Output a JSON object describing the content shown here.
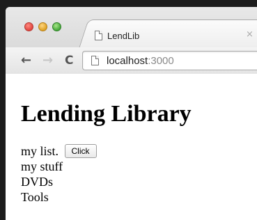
{
  "browser": {
    "tab_title": "LendLib",
    "tab_close": "×",
    "url_host": "localhost",
    "url_port": ":3000",
    "nav": {
      "back": "←",
      "forward": "→",
      "reload": "C"
    }
  },
  "page": {
    "heading": "Lending Library",
    "list_label": "my list.",
    "click_button": "Click",
    "items": [
      "my stuff",
      "DVDs",
      "Tools"
    ]
  }
}
